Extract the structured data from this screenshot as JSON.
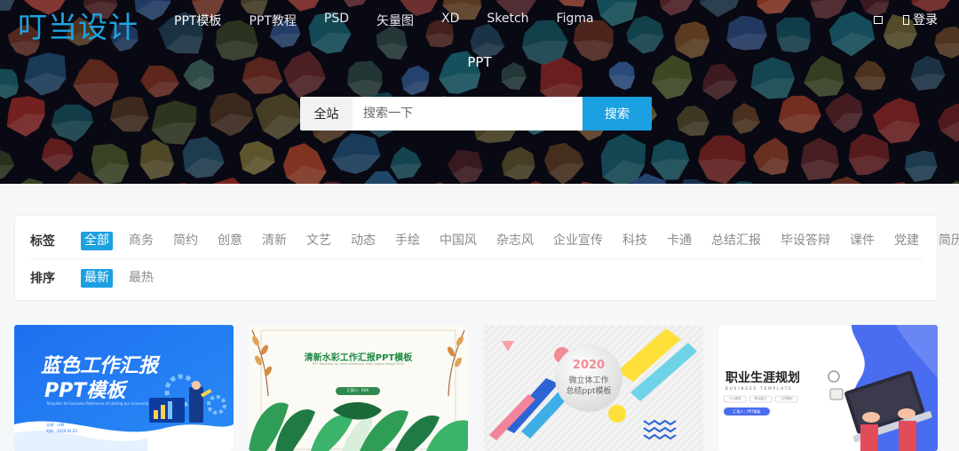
{
  "header": {
    "logo": "叮当设计",
    "nav": [
      "PPT模板",
      "PPT教程",
      "PSD",
      "矢量图",
      "XD",
      "Sketch",
      "Figma"
    ],
    "login_label": "登录",
    "message_icon": "message-icon",
    "user_icon": "user-icon"
  },
  "hero": {
    "title": "PPT",
    "search": {
      "scope": "全站",
      "placeholder": "搜索一下",
      "button": "搜索"
    }
  },
  "filters": {
    "tags_label": "标签",
    "tags": [
      "全部",
      "商务",
      "简约",
      "创意",
      "清新",
      "文艺",
      "动态",
      "手绘",
      "中国风",
      "杂志风",
      "企业宣传",
      "科技",
      "卡通",
      "总结汇报",
      "毕设答辩",
      "课件",
      "党建",
      "简历"
    ],
    "active_tag": "全部",
    "sort_label": "排序",
    "sort": [
      "最新",
      "最热"
    ],
    "active_sort": "最新"
  },
  "cards": [
    {
      "title_line1": "蓝色工作汇报",
      "title_line2": "PPT模板",
      "subtitle": "Template for business Reference of sharing our university",
      "foot1": "主讲：小明",
      "foot2": "时间：2020.02.02"
    },
    {
      "title": "清新水彩工作汇报PPT模板",
      "subtitle": "PPT Template for fresh watercolor work report design 2020",
      "pill": "汇报人：XXX"
    },
    {
      "title_line1": "2020",
      "title_line2": "微立体工作",
      "title_line3": "总结ppt模板"
    },
    {
      "title": "职业生涯规划",
      "subtitle": "BUSINESS TEMPLATE",
      "tag1": "个人规划",
      "tag2": "职业能力",
      "tag3": "工作规划",
      "pill": "汇报人：PPT模板"
    }
  ],
  "colors": {
    "accent": "#1ba0e2",
    "logo": "#1da4e0"
  }
}
